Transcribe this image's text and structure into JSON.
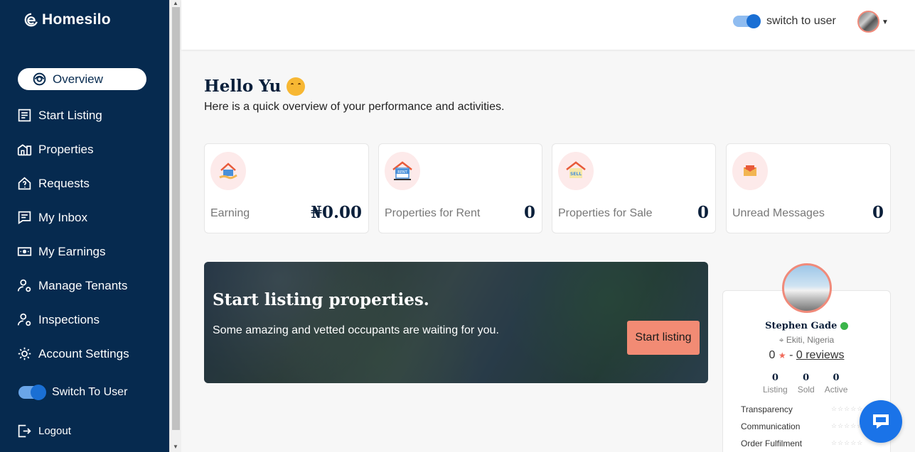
{
  "brand": {
    "name": "Homesilo"
  },
  "sidebar": {
    "items": [
      {
        "label": "Overview",
        "icon": "eye-icon"
      },
      {
        "label": "Start Listing",
        "icon": "document-icon"
      },
      {
        "label": "Properties",
        "icon": "building-icon"
      },
      {
        "label": "Requests",
        "icon": "house-question-icon"
      },
      {
        "label": "My Inbox",
        "icon": "chat-icon"
      },
      {
        "label": "My Earnings",
        "icon": "money-icon"
      },
      {
        "label": "Manage Tenants",
        "icon": "user-gear-icon"
      },
      {
        "label": "Inspections",
        "icon": "user-gear-icon"
      },
      {
        "label": "Account Settings",
        "icon": "gear-icon"
      }
    ],
    "switch_label": "Switch To User",
    "logout_label": "Logout"
  },
  "topbar": {
    "switch_label": "switch to user"
  },
  "main": {
    "greeting": "Hello Yu",
    "subtitle": "Here is a quick overview of your performance and activities.",
    "cards": [
      {
        "label": "Earning",
        "value": "₦0.00"
      },
      {
        "label": "Properties for Rent",
        "value": "0",
        "badge": "RENT"
      },
      {
        "label": "Properties for Sale",
        "value": "0",
        "badge": "SELL"
      },
      {
        "label": "Unread Messages",
        "value": "0"
      }
    ],
    "banner": {
      "title": "Start listing properties.",
      "text": "Some amazing and vetted occupants are waiting for you.",
      "button": "Start listing"
    }
  },
  "profile": {
    "name": "Stephen Gade",
    "location": "Ekiti, Nigeria",
    "rating": "0",
    "reviews": "0 reviews",
    "stats": [
      {
        "value": "0",
        "label": "Listing"
      },
      {
        "value": "0",
        "label": "Sold"
      },
      {
        "value": "0",
        "label": "Active"
      }
    ],
    "ratings": [
      {
        "label": "Transparency"
      },
      {
        "label": "Communication"
      },
      {
        "label": "Order Fulfilment"
      }
    ]
  },
  "colors": {
    "sidebar": "#062a4f",
    "accent": "#f28b74",
    "toggle": "#1a6fd4"
  }
}
